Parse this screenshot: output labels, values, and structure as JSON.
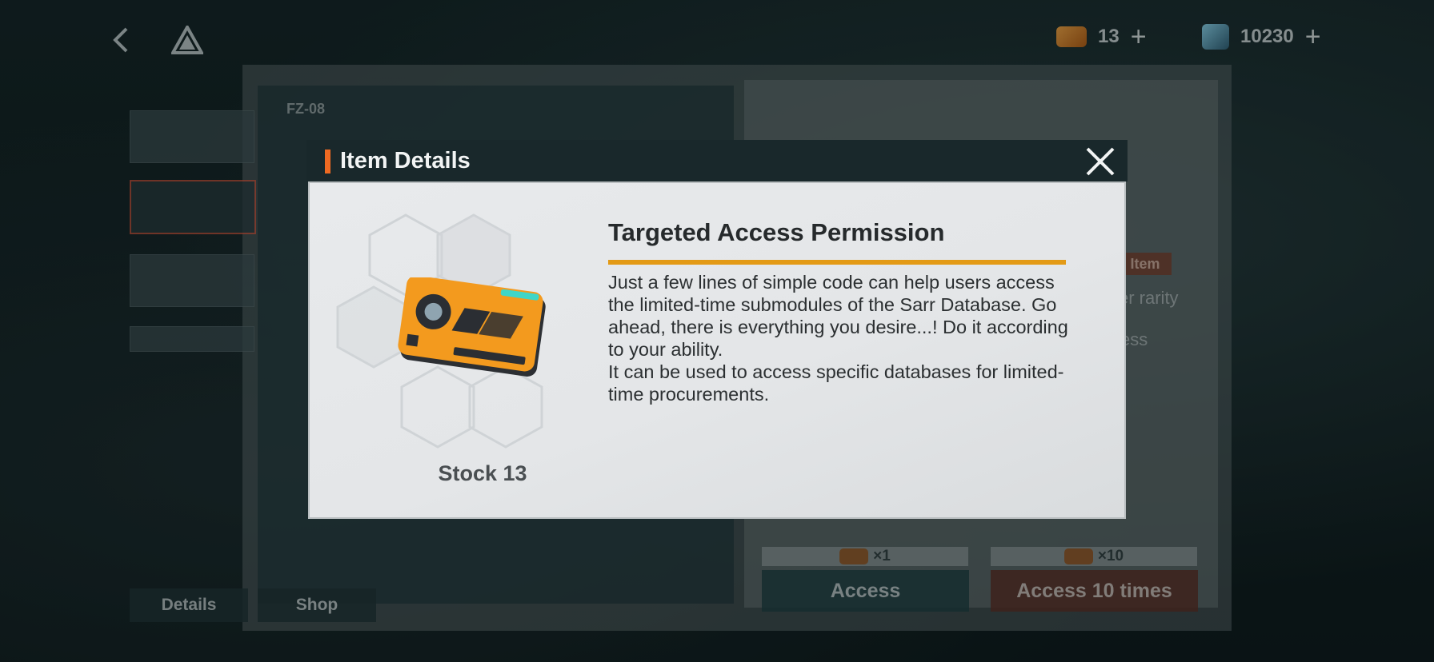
{
  "top_bar": {
    "back_icon": "chevron-left-icon",
    "logo_icon": "triangle-logo-icon",
    "resources": [
      {
        "icon": "access-permission-icon",
        "value": "13",
        "color": "#e28a2b"
      },
      {
        "icon": "collapse-piece-icon",
        "value": "10230",
        "color": "#5aa6c8"
      }
    ]
  },
  "background": {
    "panel_code": "FZ-08",
    "tabs": [
      "Details",
      "Shop"
    ],
    "side_texts": [
      "Item",
      "er rarity",
      "ess"
    ],
    "cost_single": "×1",
    "cost_ten": "×10",
    "access_label": "Access",
    "access10_label": "Access 10 times"
  },
  "modal": {
    "title": "Item Details",
    "accent_color": "#ee6a22",
    "item_name": "Targeted Access Permission",
    "stock_label": "Stock 13",
    "description": [
      "Just a few lines of simple code can help users access the limited-time submodules of the Sarr Database. Go ahead, there is everything you desire...! Do it according to your ability.",
      "It can be used to access specific databases for limited-time procurements."
    ]
  }
}
